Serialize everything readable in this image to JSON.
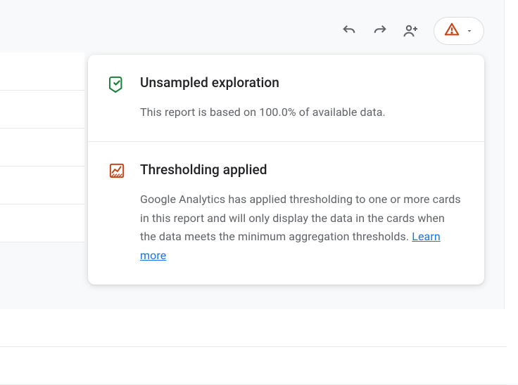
{
  "colors": {
    "green": "#188038",
    "orange": "#c5471c",
    "link": "#1a73e8"
  },
  "popup": {
    "sections": [
      {
        "icon": "shield-check",
        "title": "Unsampled exploration",
        "body": "This report is based on 100.0% of available data."
      },
      {
        "icon": "chart-hatched",
        "title": "Thresholding applied",
        "body": "Google Analytics has applied thresholding to one or more cards in this report and will only display the data in the cards when the data meets the minimum aggregation thresholds. ",
        "link_text": "Learn more"
      }
    ]
  }
}
